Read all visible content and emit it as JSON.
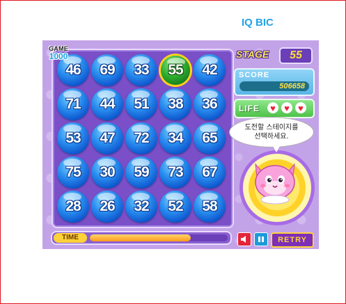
{
  "page": {
    "title": "IQ BIC"
  },
  "logo": {
    "line1": "GAME",
    "line2": "1000"
  },
  "game": {
    "stage_label": "STAGE",
    "stage": "55",
    "score_label": "SCORE",
    "score": "506658",
    "life_label": "LIFE",
    "lives": 3,
    "speech": "도전할 스테이지를\n선택하세요.",
    "time_label": "TIME",
    "time_remaining": 0.73,
    "retry_label": "RETRY",
    "numbers": [
      [
        "46",
        "69",
        "33",
        "55",
        "42"
      ],
      [
        "71",
        "44",
        "51",
        "38",
        "36"
      ],
      [
        "53",
        "47",
        "72",
        "34",
        "65"
      ],
      [
        "75",
        "30",
        "59",
        "73",
        "67"
      ],
      [
        "28",
        "26",
        "32",
        "52",
        "58"
      ]
    ],
    "selected": "55",
    "colors": {
      "ball": "#2a8ef0",
      "selected_ball": "#2fae2f",
      "background": "#c3a3e8"
    }
  }
}
